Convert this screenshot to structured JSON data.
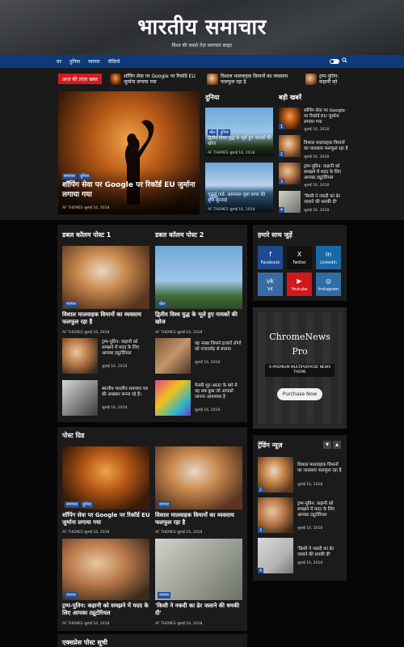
{
  "header": {
    "title": "भारतीय समाचार",
    "tagline": "विश्व की सबसे तेज़ समाचार साइट"
  },
  "nav": {
    "items": [
      "घर",
      "दुनिया",
      "व्यापार",
      "वीडियो"
    ]
  },
  "ticker": {
    "badge": "आज की ताज़ा खबर",
    "items": [
      "शॉपिंग सेवा पर Google पर रिकॉर्ड EU जुर्माना लगाया गया",
      "विशाल मालवाहक विमानों का व्यवसाय फलफूल रहा है",
      "ट्रम्प-पुतिन: कहानी को समझने में मदद के लिए आपका ट्यूटोरियल"
    ]
  },
  "hero": {
    "cats": [
      "समाचार",
      "दुनिया"
    ],
    "title": "शॉपिंग सेवा पर Google पर रिकॉर्ड EU जुर्माना लगाया गया",
    "meta": "AF THEMES   जुलाई 16, 2018"
  },
  "world": {
    "title": "दुनिया",
    "posts": [
      {
        "cats": [
          "खेल",
          "दुनिया"
        ],
        "title": "द्वितीय विश्व युद्ध के भूले हुए नायकों की खोज",
        "meta": "AF THEMES   जुलाई 16, 2018"
      },
      {
        "cats": [
          "दुनिया"
        ],
        "title": "चार्ल्स गार्ड: अस्पताल पूछा बच्चा की सुनी सुनवाई",
        "meta": "AF THEMES   जुलाई 16, 2018"
      }
    ]
  },
  "big_news": {
    "title": "बड़ी खबरें",
    "items": [
      {
        "num": "1",
        "title": "शॉपिंग सेवा पर Google पर रिकॉर्ड EU जुर्माना लगाया गया",
        "meta": "जुलाई 16, 2018"
      },
      {
        "num": "2",
        "title": "विशाल मालवाहक विमानों का व्यवसाय फलफूल रहा है",
        "meta": "जुलाई 16, 2018"
      },
      {
        "num": "3",
        "title": "ट्रम्प-पुतिन: कहानी को समझने में मदद के लिए आपका ट्यूटोरियल",
        "meta": "जुलाई 16, 2018"
      },
      {
        "num": "4",
        "title": "'किसी ने नकदी का ढेर जलाने की धमकी दी'",
        "meta": "जुलाई 16, 2018"
      }
    ]
  },
  "double_col": {
    "col1_title": "डबल कॉलम पोस्ट 1",
    "col2_title": "डबल कॉलम पोस्ट 2",
    "col1_main": {
      "cat": "व्यापार",
      "title": "विशाल मालवाहक विमानों का व्यवसाय फलफूल रहा है",
      "meta": "AF THEMES   जुलाई 16, 2018"
    },
    "col2_main": {
      "cat": "खेल",
      "title": "द्वितीय विश्व युद्ध के भूले हुए नायकों की खोज",
      "meta": "AF THEMES   जुलाई 16, 2018"
    },
    "col1_list": [
      {
        "title": "ट्रम्प-पुतिन: कहानी को समझने में मदद के लिए आपका ट्यूटोरियल",
        "meta": "जुलाई 16, 2018"
      },
      {
        "title": "स्थानीय भारतीय समाचार पत्र फ्री अखबार बनना रहे हैं।",
        "meta": "जुलाई 16, 2018"
      }
    ],
    "col2_list": [
      {
        "title": "वह नाखा जिसने हजारों लोगों को एचएलोड़ से बचाया",
        "meta": "जुलाई 16, 2018"
      },
      {
        "title": "पेनसी शूट-आउट के बारे में वह सब कुछ जो आपको जानना आवश्यक है",
        "meta": "जुलाई 16, 2018"
      }
    ]
  },
  "social": {
    "title": "हमारे साथ जुड़ें",
    "items": [
      {
        "label": "Facebook",
        "icon": "f",
        "color": "#1e4a8f"
      },
      {
        "label": "Twitter",
        "icon": "X",
        "color": "#111111"
      },
      {
        "label": "Linkedin",
        "icon": "in",
        "color": "#1869a8"
      },
      {
        "label": "VK",
        "icon": "vk",
        "color": "#3a6aa3"
      },
      {
        "label": "Youtube",
        "icon": "▶",
        "color": "#d0181e"
      },
      {
        "label": "Instagram",
        "icon": "◎",
        "color": "#2f6ca8"
      }
    ]
  },
  "promo": {
    "brand": "ChromeNews",
    "edition": "Pro",
    "subtitle": "A PREMIUM MULTIPURPOSE NEWS THEME",
    "button": "Purchase Now"
  },
  "post_grid": {
    "title": "पोस्ट ग्रिड",
    "items": [
      {
        "cats": [
          "समाचार",
          "दुनिया"
        ],
        "title": "शॉपिंग सेवा पर Google पर रिकॉर्ड EU जुर्माना लगाया गया",
        "meta": "AF THEMES   जुलाई 16, 2018"
      },
      {
        "cats": [
          "व्यापार"
        ],
        "title": "विशाल मालवाहक विमानों का व्यवसाय फलफूल रहा है",
        "meta": "AF THEMES   जुलाई 16, 2018"
      },
      {
        "cats": [
          "व्यापार"
        ],
        "title": "ट्रम्प-पुतिन: कहानी को समझने में मदद के लिए आपका ट्यूटोरियल",
        "meta": "AF THEMES   जुलाई 16, 2018"
      },
      {
        "cats": [
          "व्यापार"
        ],
        "title": "'किसी ने नकदी का ढेर जलाने की धमकी दी'",
        "meta": "AF THEMES   जुलाई 16, 2018"
      }
    ]
  },
  "trending": {
    "title": "ट्रेंडिंग न्यूज़",
    "items": [
      {
        "num": "2",
        "title": "विशाल मालवाहक विमानों का व्यवसाय फलफूल रहा है",
        "meta": "जुलाई 16, 2018"
      },
      {
        "num": "3",
        "title": "ट्रम्प-पुतिन: कहानी को समझने में मदद के लिए आपका ट्यूटोरियल",
        "meta": "जुलाई 16, 2018"
      },
      {
        "num": "4",
        "title": "'किसी ने नकदी का ढेर जलाने की धमकी दी'",
        "meta": "जुलाई 16, 2018"
      }
    ]
  },
  "express": {
    "title": "एक्सप्रेस पोस्ट सूची"
  }
}
